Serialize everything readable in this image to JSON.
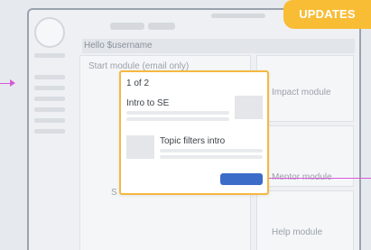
{
  "updates_badge": {
    "label": "UPDATES"
  },
  "header": {
    "greeting": "Hello $username"
  },
  "modules": {
    "start": {
      "label": "Start module (email only)",
      "sub_fragment": "S"
    },
    "impact": {
      "label": "Impact module"
    },
    "mentor": {
      "label": "Mentor module"
    },
    "help": {
      "label": "Help module"
    }
  },
  "popover": {
    "pager": "1 of 2",
    "items": [
      {
        "title": "Intro to SE"
      },
      {
        "title": "Topic filters intro"
      }
    ]
  },
  "colors": {
    "badge": "#f8bd35",
    "popover_border": "#f5b841",
    "button": "#3b6cc8",
    "connector": "#d65ad6"
  }
}
